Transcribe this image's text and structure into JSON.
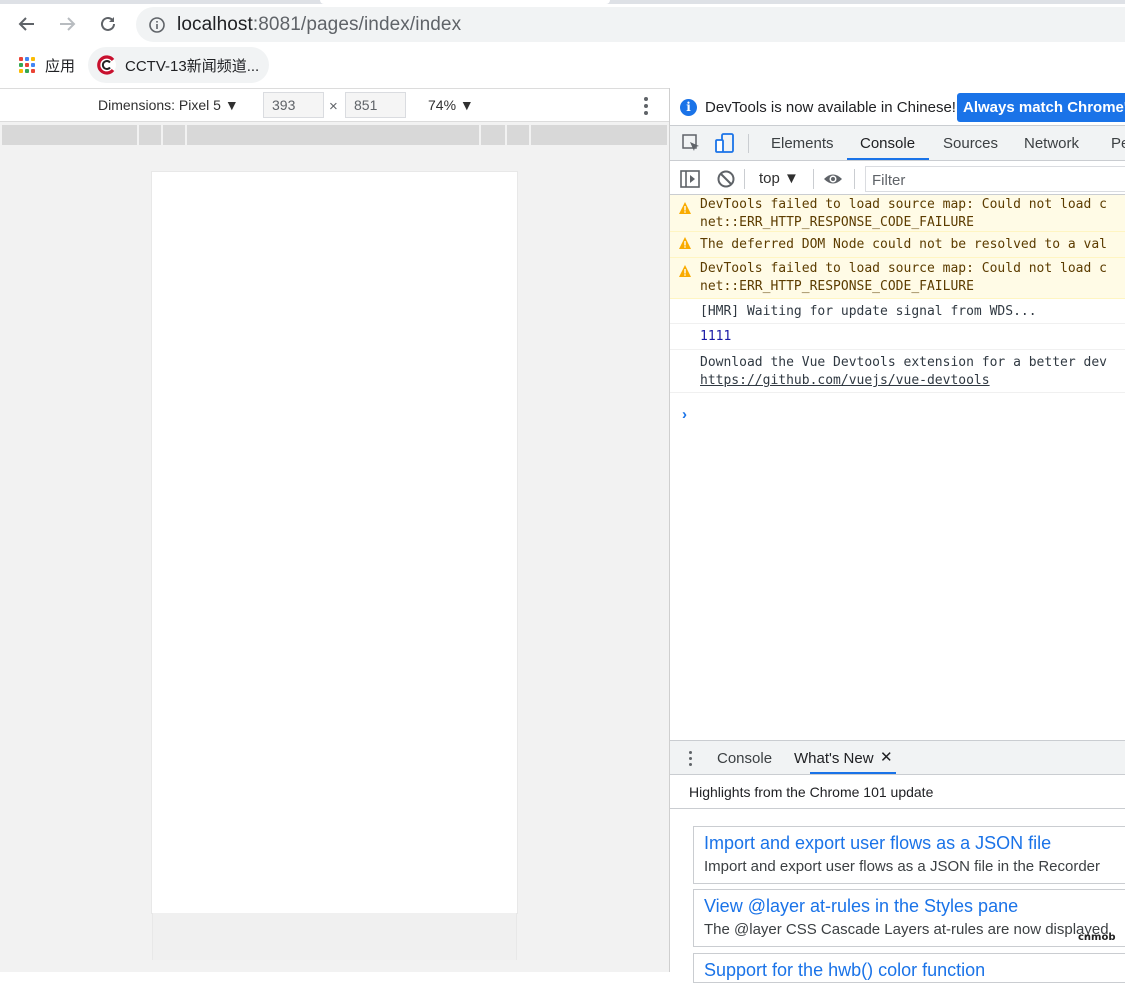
{
  "browser": {
    "url_host": "localhost",
    "url_rest": ":8081/pages/index/index",
    "bookmarks": [
      {
        "label": "应用"
      },
      {
        "label": "CCTV-13新闻频道..."
      }
    ]
  },
  "device_toolbar": {
    "dimensions_label": "Dimensions: Pixel 5 ▼",
    "width": "393",
    "height": "851",
    "times": "×",
    "zoom": "74% ▼"
  },
  "devtools": {
    "infobar": {
      "text": "DevTools is now available in Chinese!",
      "button": "Always match Chrome's"
    },
    "tabs": [
      {
        "label": "Elements"
      },
      {
        "label": "Console"
      },
      {
        "label": "Sources"
      },
      {
        "label": "Network"
      },
      {
        "label": "Pe"
      }
    ],
    "console_bar": {
      "context": "top ▼",
      "filter_placeholder": "Filter"
    },
    "messages": [
      {
        "type": "warn",
        "line1": "DevTools failed to load source map: Could not load c",
        "line2": "net::ERR_HTTP_RESPONSE_CODE_FAILURE"
      },
      {
        "type": "warn",
        "line1": "The deferred DOM Node could not be resolved to a val"
      },
      {
        "type": "warn",
        "line1": "DevTools failed to load source map: Could not load c",
        "line2": "net::ERR_HTTP_RESPONSE_CODE_FAILURE"
      },
      {
        "type": "log",
        "line1": "[HMR] Waiting for update signal from WDS..."
      },
      {
        "type": "num",
        "line1": "1111"
      },
      {
        "type": "log",
        "line1": "Download the Vue Devtools extension for a better dev",
        "link": "https://github.com/vuejs/vue-devtools"
      }
    ],
    "prompt": "›",
    "drawer": {
      "tabs": [
        {
          "label": "Console"
        },
        {
          "label": "What's New"
        }
      ],
      "close": "✕",
      "highlights": "Highlights from the Chrome 101 update",
      "cards": [
        {
          "title": "Import and export user flows as a JSON file",
          "desc": "Import and export user flows as a JSON file in the Recorder"
        },
        {
          "title": "View @layer at-rules in the Styles pane",
          "desc": "The @layer CSS Cascade Layers at-rules are now displayed"
        },
        {
          "title": "Support for the hwb() color function",
          "desc": ""
        }
      ]
    }
  },
  "watermark": "cnmob",
  "colors": {
    "accent": "#1a73e8",
    "warn_bg": "#fffbe6",
    "warn_text": "#5c3c00"
  }
}
